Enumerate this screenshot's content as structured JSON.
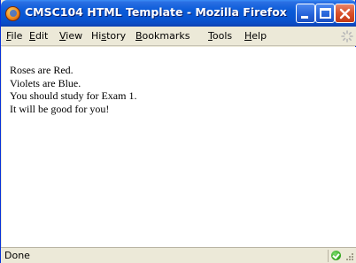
{
  "window": {
    "title": "CMSC104 HTML Template - Mozilla Firefox"
  },
  "menu": [
    {
      "label": "File",
      "accel": "F",
      "rest": "ile"
    },
    {
      "label": "Edit",
      "accel": "E",
      "rest": "dit"
    },
    {
      "label": "View",
      "accel": "V",
      "rest": "iew"
    },
    {
      "label": "History",
      "pre": "Hi",
      "accel": "s",
      "rest": "tory"
    },
    {
      "label": "Bookmarks",
      "accel": "B",
      "rest": "ookmarks"
    },
    {
      "label": "Tools",
      "accel": "T",
      "rest": "ools"
    },
    {
      "label": "Help",
      "accel": "H",
      "rest": "elp"
    }
  ],
  "content": {
    "lines": [
      "Roses are Red.",
      "Violets are Blue.",
      "You should study for Exam 1.",
      "It will be good for you!"
    ]
  },
  "status": {
    "text": "Done"
  },
  "icons": {
    "app": "firefox-icon",
    "throbber": "throbber-icon",
    "secure": "status-ok-icon",
    "grip": "resize-grip-icon"
  }
}
